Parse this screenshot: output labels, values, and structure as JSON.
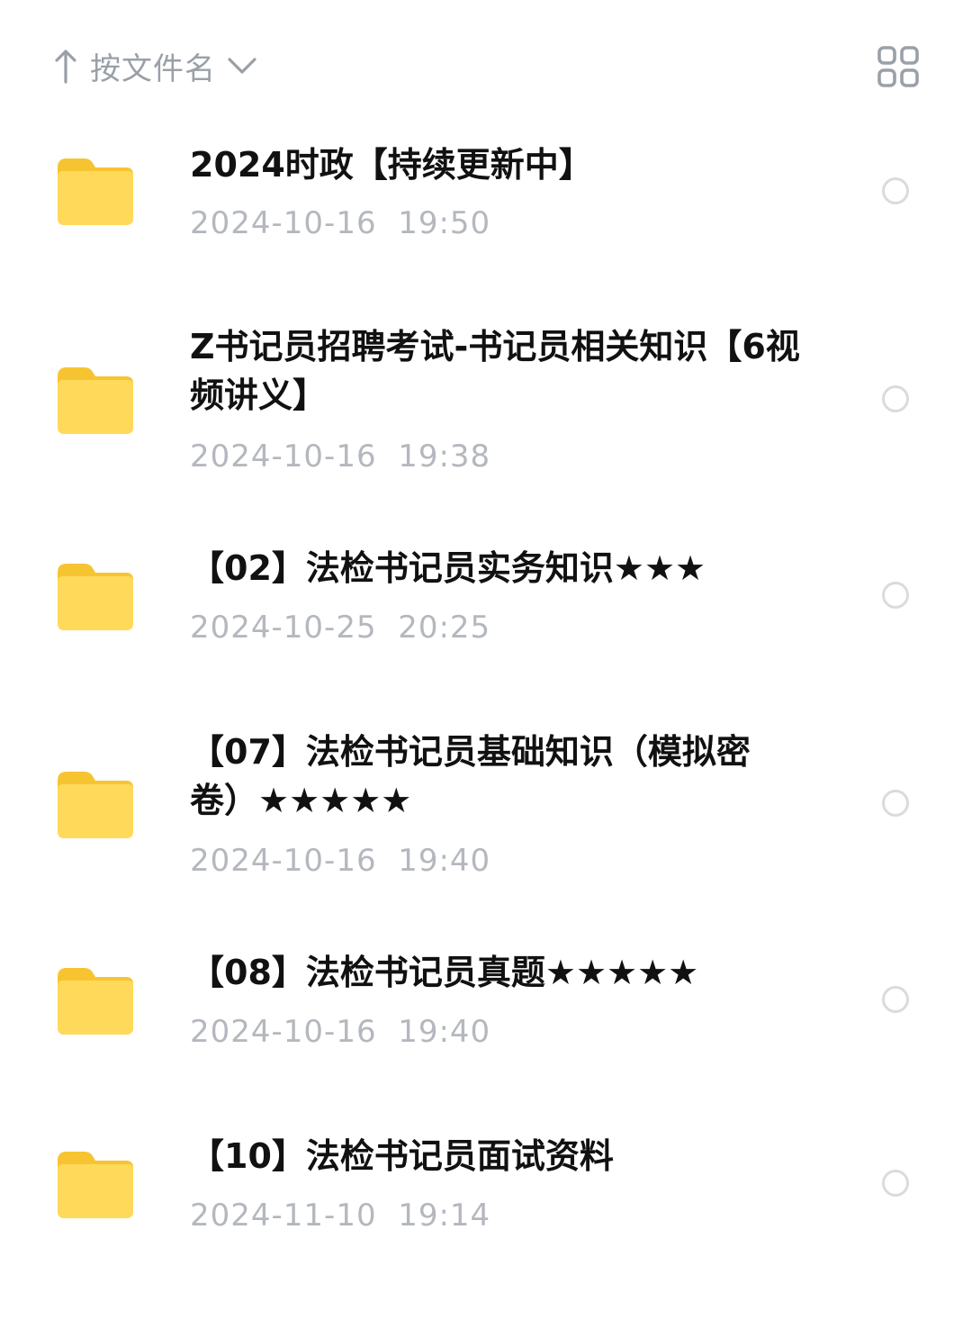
{
  "toolbar": {
    "sort_label": "按文件名",
    "sort_icon": "arrow-up-icon",
    "sort_dropdown_icon": "chevron-down-icon",
    "view_toggle_icon": "grid-view-icon"
  },
  "colors": {
    "folder": "#FFD54F",
    "title_text": "#111111",
    "date_text": "#B4B8BE",
    "muted_text": "#9AA0A8"
  },
  "files": [
    {
      "name": "2024时政【持续更新中】",
      "date": "2024-10-16  19:50"
    },
    {
      "name": "Z书记员招聘考试-书记员相关知识【6视频讲义】",
      "date": "2024-10-16  19:38"
    },
    {
      "name": "【02】法检书记员实务知识★★★",
      "date": "2024-10-25  20:25"
    },
    {
      "name": "【07】法检书记员基础知识（模拟密卷）★★★★★",
      "date": "2024-10-16  19:40"
    },
    {
      "name": "【08】法检书记员真题★★★★★",
      "date": "2024-10-16  19:40"
    },
    {
      "name": "【10】法检书记员面试资料",
      "date": "2024-11-10  19:14"
    }
  ]
}
